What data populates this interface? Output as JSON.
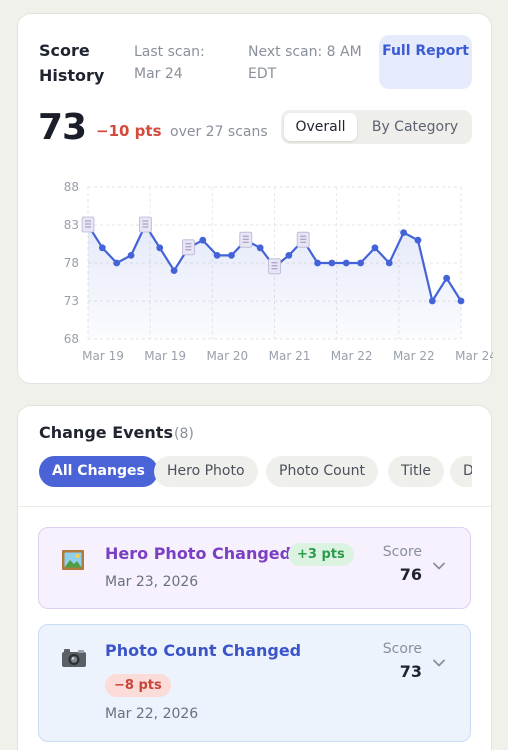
{
  "score_history": {
    "title": "Score History",
    "last_scan": "Last scan: Mar 24",
    "next_scan": "Next scan: 8 AM EDT",
    "full_report_label": "Full Report",
    "score": "73",
    "delta": "−10 pts",
    "scan_info": "over 27 scans",
    "view_toggle": [
      "Overall",
      "By Category"
    ],
    "selected_view": "Overall"
  },
  "chart_data": {
    "type": "line",
    "x": [
      "Mar 19",
      "Mar 19",
      "Mar 19",
      "Mar 19",
      "Mar 19",
      "Mar 19",
      "Mar 19",
      "Mar 20",
      "Mar 20",
      "Mar 20",
      "Mar 20",
      "Mar 21",
      "Mar 21",
      "Mar 21",
      "Mar 21",
      "Mar 21",
      "Mar 22",
      "Mar 22",
      "Mar 22",
      "Mar 22",
      "Mar 22",
      "Mar 22",
      "Mar 23",
      "Mar 23",
      "Mar 23",
      "Mar 24",
      "Mar 24"
    ],
    "x_tick_labels": [
      "Mar 19",
      "Mar 19",
      "Mar 20",
      "Mar 21",
      "Mar 22",
      "Mar 22",
      "Mar 24"
    ],
    "values": [
      83,
      80,
      78,
      79,
      83,
      80,
      77,
      80,
      81,
      79,
      79,
      81,
      80,
      77.5,
      79,
      81,
      78,
      78,
      78,
      78,
      80,
      78,
      82,
      81,
      73,
      76,
      73
    ],
    "event_marker_indices": [
      0,
      4,
      7,
      11,
      13,
      15
    ],
    "y_ticks": [
      88,
      83,
      78,
      73,
      68
    ],
    "ylim": [
      68,
      88
    ],
    "grid": true,
    "line_color": "#4563d8",
    "title": "",
    "xlabel": "",
    "ylabel": ""
  },
  "change_events": {
    "title": "Change Events",
    "count": "(8)",
    "filters": [
      "All Changes",
      "Hero Photo",
      "Photo Count",
      "Title",
      "D"
    ],
    "active_filter": "All Changes",
    "score_label": "Score",
    "items": [
      {
        "icon": "framed-picture-icon",
        "name": "Hero Photo Changed",
        "badge": "+3 pts",
        "badge_kind": "positive",
        "date": "Mar 23, 2026",
        "score": "76"
      },
      {
        "icon": "camera-icon",
        "name": "Photo Count Changed",
        "badge": "−8 pts",
        "badge_kind": "negative",
        "date": "Mar 22, 2026",
        "score": "73"
      }
    ]
  },
  "colors": {
    "accent": "#4a63d6",
    "negative": "#d24b3c",
    "positive": "#2d9b4e",
    "hero_photo": "#7b3fc4",
    "photo_count": "#3b55c9"
  }
}
